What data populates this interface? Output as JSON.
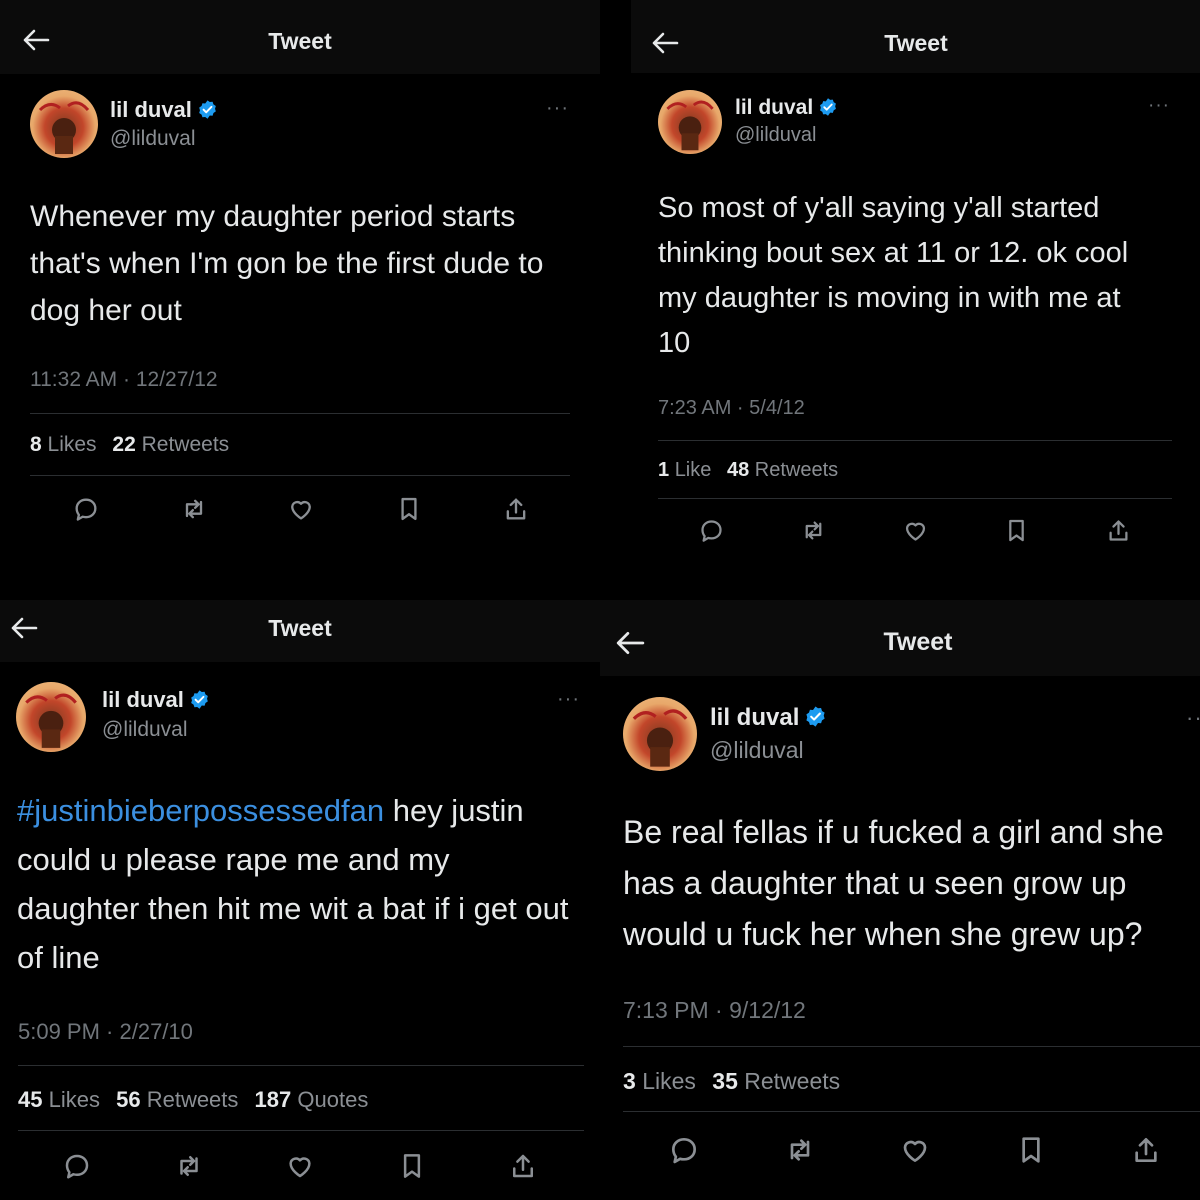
{
  "panels": [
    {
      "header_title": "Tweet",
      "name": "lil duval",
      "handle": "@lilduval",
      "more": "···",
      "text": "Whenever my daughter period starts that's when I'm gon be the first dude to dog her out",
      "timestamp": "11:32 AM · 12/27/12",
      "stats": [
        {
          "count": "8",
          "label": "Likes"
        },
        {
          "count": "22",
          "label": "Retweets"
        }
      ]
    },
    {
      "header_title": "Tweet",
      "name": "lil duval",
      "handle": "@lilduval",
      "more": "···",
      "text": "So most of y'all saying y'all started thinking bout sex at 11 or 12. ok cool my daughter is moving in with me at 10",
      "timestamp": "7:23 AM · 5/4/12",
      "stats": [
        {
          "count": "1",
          "label": "Like"
        },
        {
          "count": "48",
          "label": "Retweets"
        }
      ]
    },
    {
      "header_title": "Tweet",
      "name": "lil duval",
      "handle": "@lilduval",
      "more": "···",
      "hashtag": "#justinbieberpossessedfan",
      "text": " hey justin could u please rape me and my daughter then hit me wit a bat if i get out of line",
      "timestamp": "5:09 PM · 2/27/10",
      "stats": [
        {
          "count": "45",
          "label": "Likes"
        },
        {
          "count": "56",
          "label": "Retweets"
        },
        {
          "count": "187",
          "label": "Quotes"
        }
      ]
    },
    {
      "header_title": "Tweet",
      "name": "lil duval",
      "handle": "@lilduval",
      "more": "··",
      "text": "Be real fellas if u fucked a girl and she has a daughter that u seen grow up would u fuck her when she grew up?",
      "timestamp": "7:13 PM · 9/12/12",
      "stats": [
        {
          "count": "3",
          "label": "Likes"
        },
        {
          "count": "35",
          "label": "Retweets"
        }
      ]
    }
  ],
  "colors": {
    "background": "#000000",
    "text": "#e7e9ea",
    "muted": "#71767b",
    "link": "#1d9bf0",
    "verified": "#1d9bf0"
  },
  "icons": [
    "back-arrow-icon",
    "verified-badge-icon",
    "more-options-icon",
    "reply-icon",
    "retweet-icon",
    "like-icon",
    "bookmark-icon",
    "share-icon"
  ]
}
